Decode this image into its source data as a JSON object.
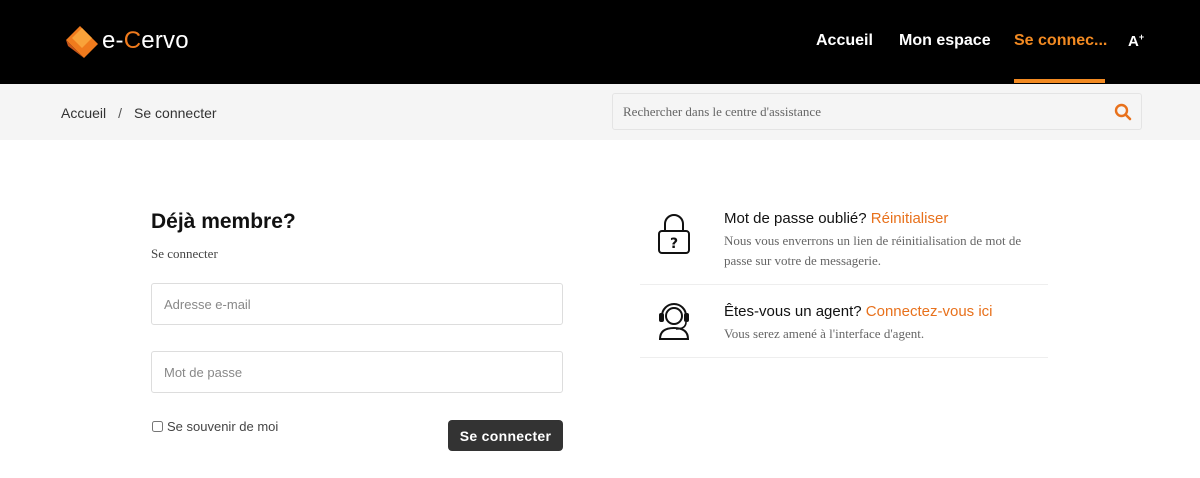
{
  "brand": {
    "name_prefix": "e-",
    "name_initial": "C",
    "name_rest": "ervo",
    "accent": "#f07b1d"
  },
  "nav": {
    "items": [
      {
        "label": "Accueil",
        "active": false
      },
      {
        "label": "Mon espace",
        "active": false
      },
      {
        "label": "Se connec...",
        "active": true
      }
    ],
    "font_toggle_label": "A",
    "font_toggle_sup": "+",
    "active_color": "#f28a22"
  },
  "breadcrumb": {
    "home": "Accueil",
    "separator": "/",
    "current": "Se connecter"
  },
  "search": {
    "placeholder": "Rechercher dans le centre d'assistance",
    "value": "",
    "icon": "search-icon"
  },
  "login": {
    "title": "Déjà membre?",
    "subtitle": "Se connecter",
    "email_placeholder": "Adresse e-mail",
    "password_placeholder": "Mot de passe",
    "remember_label": "Se souvenir de moi",
    "remember_checked": false,
    "submit_label": "Se connecter"
  },
  "help": [
    {
      "icon": "padlock-question-icon",
      "title": "Mot de passe oublié?",
      "link": "Réinitialiser",
      "description": "Nous vous enverrons un lien de réinitialisation de mot de passe sur votre de messagerie."
    },
    {
      "icon": "headset-agent-icon",
      "title": "Êtes-vous un agent?",
      "link": "Connectez-vous ici",
      "description": "Vous serez amené à l'interface d'agent."
    }
  ]
}
